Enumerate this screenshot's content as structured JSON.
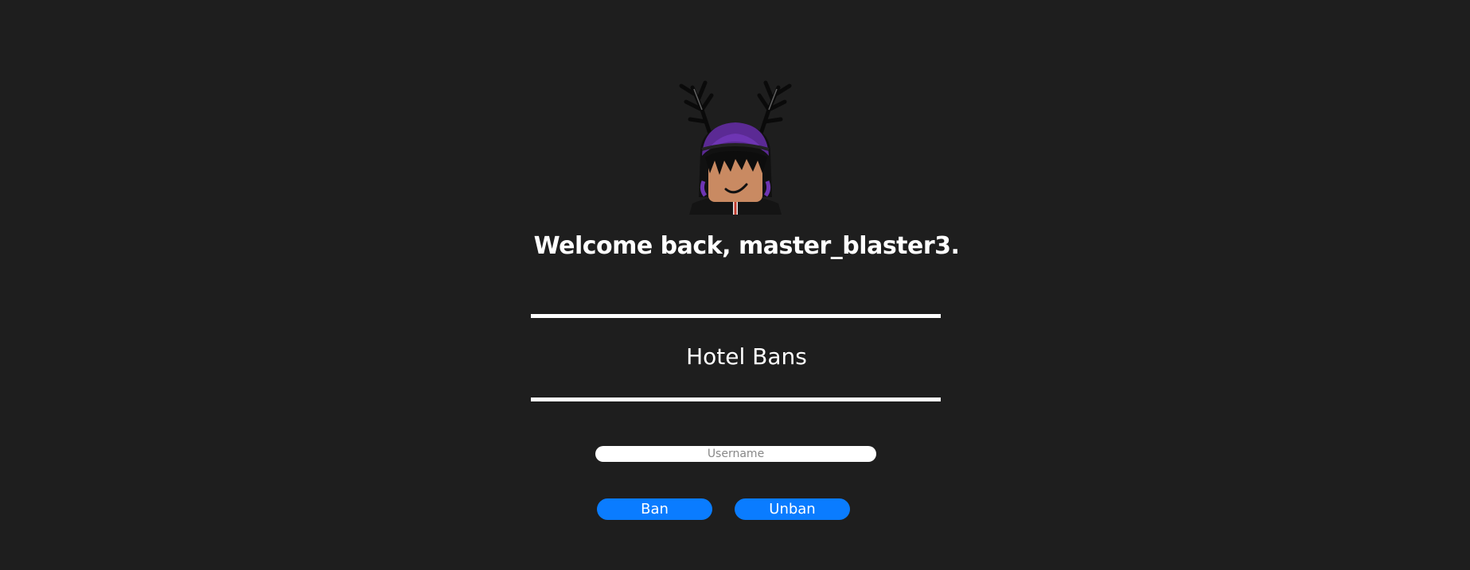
{
  "header": {
    "welcome_text": "Welcome back, master_blaster3."
  },
  "section": {
    "title": "Hotel Bans"
  },
  "form": {
    "username_placeholder": "Username",
    "username_value": "",
    "ban_label": "Ban",
    "unban_label": "Unban"
  },
  "colors": {
    "background": "#1e1e1e",
    "button": "#0a7cff",
    "text": "#ffffff"
  }
}
